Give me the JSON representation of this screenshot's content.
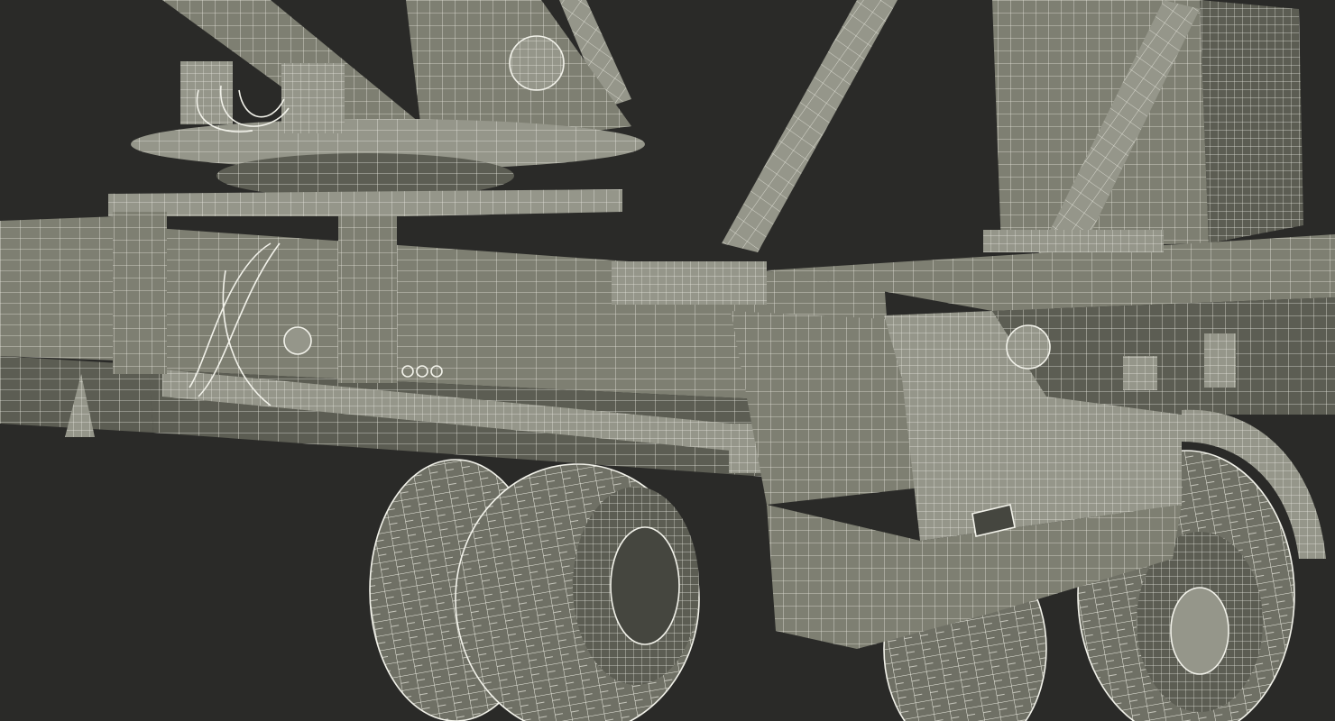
{
  "scene": {
    "subject": "wireframe-render",
    "colors": {
      "background": "#2a2a28",
      "mesh": "#7e7f72",
      "mesh_dark": "#5c5d53",
      "mesh_light": "#95968a",
      "wireframe_lines": "#e8e8de"
    }
  }
}
